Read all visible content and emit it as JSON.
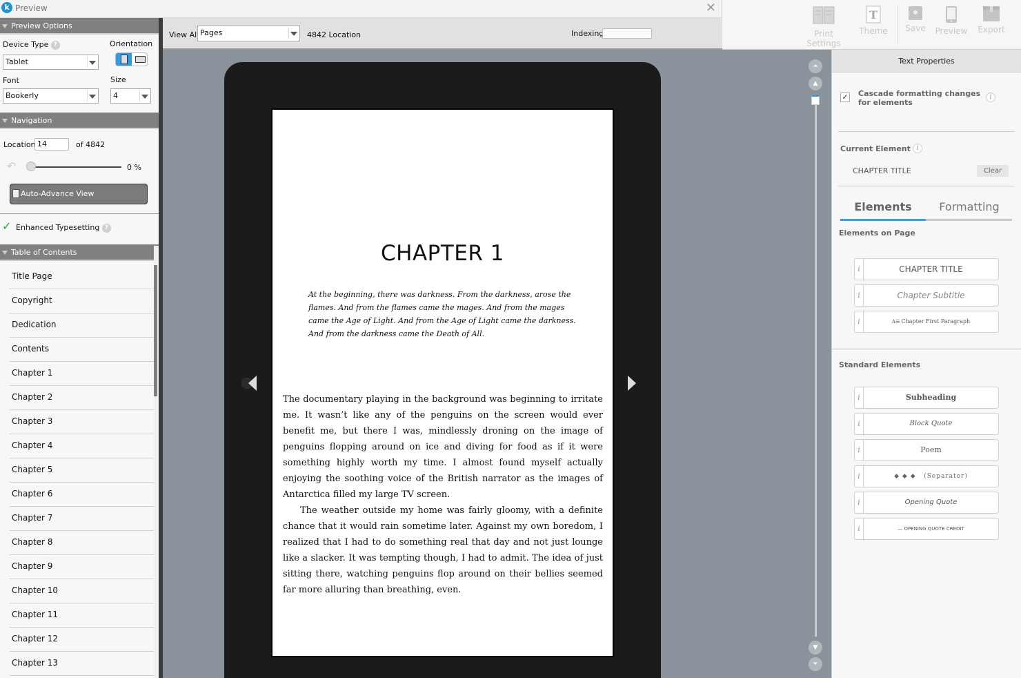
{
  "window": {
    "title": "Preview",
    "logo": "k",
    "close_icon": "close-icon"
  },
  "app_toolbar": {
    "items": [
      {
        "label": "Print Settings",
        "icon": "book-icon"
      },
      {
        "label": "Theme",
        "icon": "theme-t-icon"
      },
      {
        "label": "Save",
        "icon": "save-icon"
      },
      {
        "label": "Preview",
        "icon": "tablet-icon"
      },
      {
        "label": "Export",
        "icon": "box-icon"
      }
    ]
  },
  "left_panel": {
    "preview_options": {
      "header": "Preview Options",
      "device_type_label": "Device Type",
      "device_type_value": "Tablet",
      "orientation_label": "Orientation",
      "orientation_selected": "portrait",
      "font_label": "Font",
      "font_value": "Bookerly",
      "size_label": "Size",
      "size_value": "4"
    },
    "navigation": {
      "header": "Navigation",
      "location_label": "Location",
      "location_value": "14",
      "of_total": "of 4842",
      "progress_percent": 0,
      "progress_text": "0 %",
      "auto_advance_label": "Auto-Advance View"
    },
    "enhanced_typesetting": {
      "label": "Enhanced Typesetting",
      "enabled": true
    },
    "toc": {
      "header": "Table of Contents",
      "items": [
        "Title Page",
        "Copyright",
        "Dedication",
        "Contents",
        "Chapter 1",
        "Chapter 2",
        "Chapter 3",
        "Chapter 4",
        "Chapter 5",
        "Chapter 6",
        "Chapter 7",
        "Chapter 8",
        "Chapter 9",
        "Chapter 10",
        "Chapter 11",
        "Chapter 12",
        "Chapter 13"
      ]
    }
  },
  "viewer_toolbar": {
    "view_all_label": "View All",
    "view_select_value": "Pages",
    "location_count": "4842 Location",
    "indexing_label": "Indexing",
    "indexing_progress": 0
  },
  "page": {
    "chapter_title": "CHAPTER 1",
    "epigraph": "At the beginning, there was darkness. From the darkness, arose the flames. And from the flames came the mages. And from the mages came the Age of Light. And from the Age of Light came the darkness. And from the darkness came the Death of All.",
    "paragraphs": [
      "The documentary playing in the background was beginning to irritate me. It wasn’t like any of the penguins on the screen would ever benefit me, but there I was, mindlessly droning on the image of penguins flop­ping around on ice and diving for food as if it were something highly worth my time. I almost found myself actually enjoying the soothing voice of the British narrator as the images of Antarctica filled my large TV screen.",
      "The weather outside my home was fairly gloomy, with a definite chance that it would rain sometime later. Against my own boredom, I realized that I had to do something real that day and not just lounge like a slacker. It was tempting though, I had to admit. The idea of just sitting there, watching penguins flop around on their bellies seemed far more alluring than breathing, even."
    ]
  },
  "right_panel": {
    "header": "Text Properties",
    "cascade_label": "Cascade formatting changes for elements",
    "cascade_checked": true,
    "current_element_label": "Current Element",
    "current_element_value": "CHAPTER TITLE",
    "clear_label": "Clear",
    "tabs": [
      {
        "label": "Elements",
        "active": true
      },
      {
        "label": "Formatting",
        "active": false
      }
    ],
    "elements_on_page_label": "Elements on Page",
    "elements_on_page": [
      "CHAPTER TITLE",
      "Chapter Subtitle",
      "Chapter First Paragraph"
    ],
    "standard_elements_label": "Standard Elements",
    "standard_elements": [
      "Subheading",
      "Block Quote",
      "Poem",
      "◆ ◆ ◆   (Separator)",
      "Opening Quote",
      "— OPENING QUOTE CREDIT"
    ],
    "info_glyph": "i"
  },
  "colors": {
    "accent": "#3aa0e6",
    "section_header": "#808080",
    "canvas": "#8a939c",
    "check": "#1ea81e"
  }
}
